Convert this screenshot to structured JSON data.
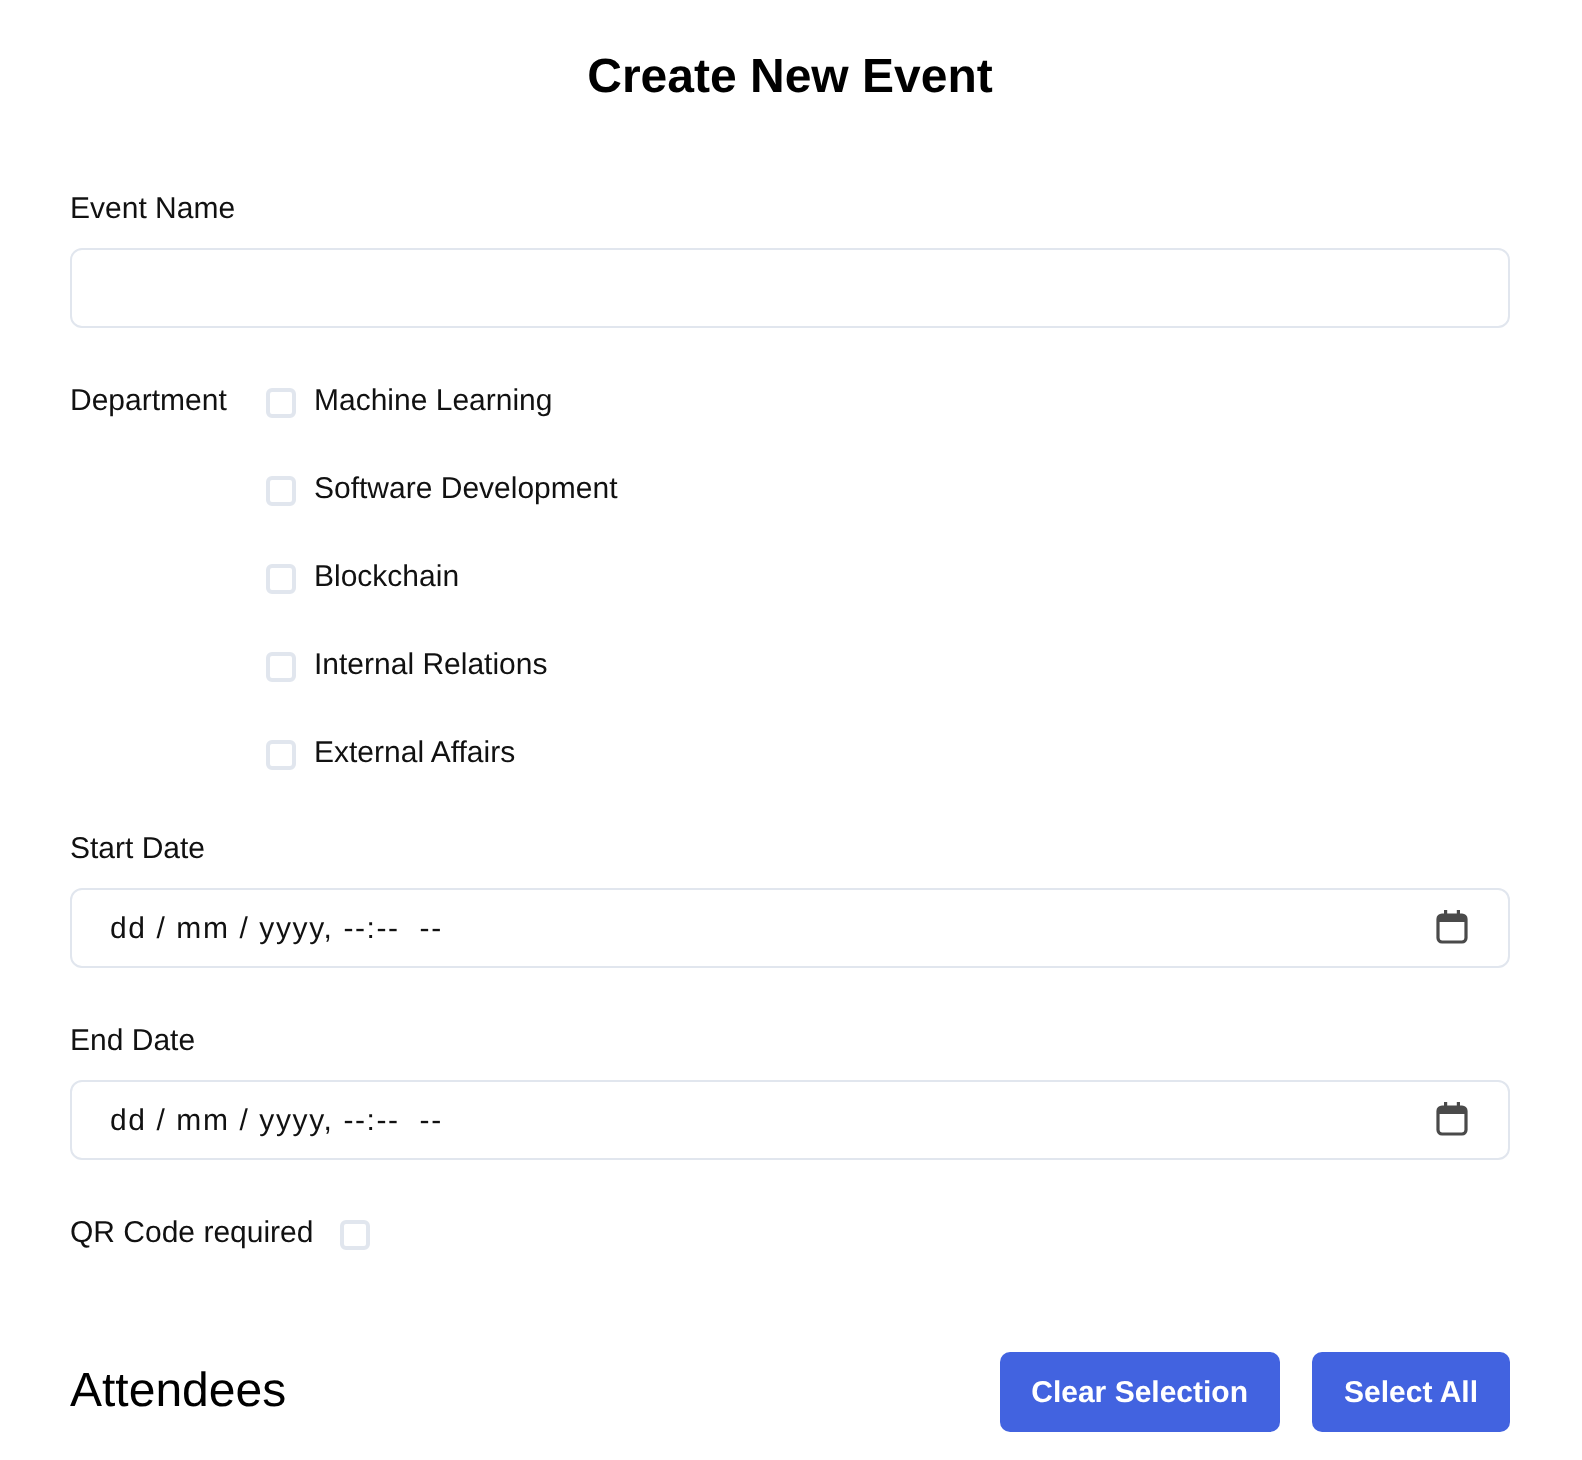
{
  "title": "Create New Event",
  "event_name": {
    "label": "Event Name"
  },
  "department": {
    "label": "Department",
    "options": [
      {
        "label": "Machine Learning",
        "checked": false
      },
      {
        "label": "Software Development",
        "checked": false
      },
      {
        "label": "Blockchain",
        "checked": false
      },
      {
        "label": "Internal Relations",
        "checked": false
      },
      {
        "label": "External Affairs",
        "checked": false
      }
    ]
  },
  "dates": [
    {
      "label": "Start Date",
      "placeholder": "dd / mm / yyyy, --:--  --"
    },
    {
      "label": "End Date",
      "placeholder": "dd / mm / yyyy, --:--  --"
    }
  ],
  "qr_code": {
    "label": "QR Code required",
    "checked": false
  },
  "attendees": {
    "heading": "Attendees",
    "buttons": [
      "Clear Selection",
      "Select All"
    ]
  }
}
